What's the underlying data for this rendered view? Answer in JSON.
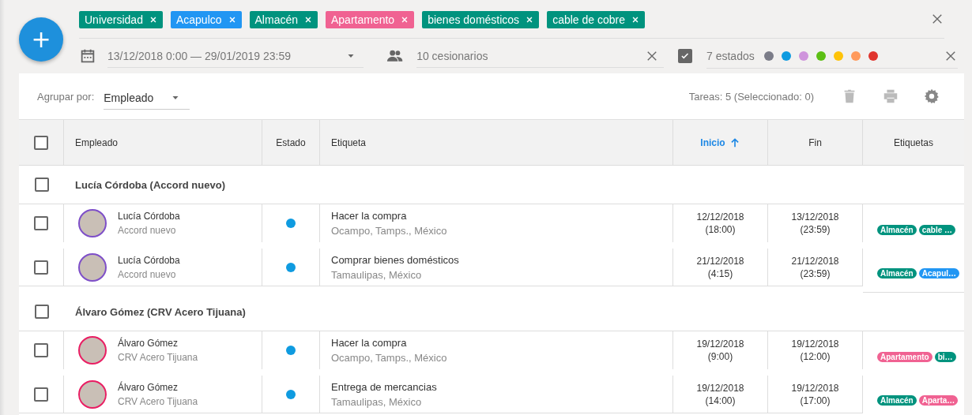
{
  "fab": {
    "label": "+"
  },
  "filter_tags": [
    {
      "label": "Universidad",
      "color": "#00937e"
    },
    {
      "label": "Acapulco",
      "color": "#2196f3"
    },
    {
      "label": "Almacén",
      "color": "#00937e"
    },
    {
      "label": "Apartamento",
      "color": "#f06292"
    },
    {
      "label": "bienes domésticos",
      "color": "#00937e"
    },
    {
      "label": "cable de cobre",
      "color": "#00937e"
    }
  ],
  "date_range": {
    "value": "13/12/2018 0:00 — 29/01/2019 23:59"
  },
  "assignees": {
    "value": "10 cesionarios"
  },
  "states": {
    "checked": true,
    "value": "7 estados",
    "colors": [
      {
        "color": "#7b7c88"
      },
      {
        "color": "#0f9be0"
      },
      {
        "color": "#cf94dc"
      },
      {
        "color": "#5cbf14"
      },
      {
        "color": "#fec309"
      },
      {
        "color": "#ff9a5c"
      },
      {
        "color": "#e0342e"
      }
    ]
  },
  "toolbar": {
    "group_label": "Agrupar por:",
    "group_value": "Empleado",
    "summary": "Tareas: 5 (Seleccionado: 0)"
  },
  "table": {
    "select_all": {
      "checked": false
    },
    "columns": [
      {
        "label": "Empleado",
        "sorted": false
      },
      {
        "label": "Estado",
        "sorted": false
      },
      {
        "label": "Etiqueta",
        "sorted": false
      },
      {
        "label": "Inicio",
        "sorted": true
      },
      {
        "label": "Fin",
        "sorted": false
      },
      {
        "label": "Etiquetas",
        "sorted": false
      }
    ],
    "groups": [
      {
        "title": "Lucía Córdoba (Accord nuevo)",
        "checked": false,
        "rows": [
          {
            "checked": false,
            "name": "Lucía Córdoba",
            "company": "Accord nuevo",
            "avatar": {
              "color": "#7e4fc8"
            },
            "status": {
              "color": "#0f9be0"
            },
            "task": "Hacer la compra",
            "place": "Ocampo, Tamps., México",
            "start": {
              "date": "12/12/2018",
              "time": "(18:00)"
            },
            "end": {
              "date": "13/12/2018",
              "time": "(23:59)"
            },
            "tags": [
              {
                "label": "Almacén",
                "color": "#00937e"
              },
              {
                "label": "cable …",
                "color": "#00937e"
              }
            ]
          },
          {
            "checked": false,
            "name": "Lucía Córdoba",
            "company": "Accord nuevo",
            "avatar": {
              "color": "#7e4fc8"
            },
            "status": {
              "color": "#0f9be0"
            },
            "task": "Comprar bienes domésticos",
            "place": "Tamaulipas, México",
            "start": {
              "date": "21/12/2018",
              "time": "(4:15)"
            },
            "end": {
              "date": "21/12/2018",
              "time": "(23:59)"
            },
            "tags": [
              {
                "label": "Almacén",
                "color": "#00937e"
              },
              {
                "label": "Acapul…",
                "color": "#2196f3"
              }
            ]
          }
        ]
      },
      {
        "title": "Álvaro Gómez (CRV Acero Tijuana)",
        "checked": false,
        "rows": [
          {
            "checked": false,
            "name": "Álvaro Gómez",
            "company": "CRV Acero Tijuana",
            "avatar": {
              "color": "#e91e63"
            },
            "status": {
              "color": "#0f9be0"
            },
            "task": "Hacer la compra",
            "place": "Ocampo, Tamps., México",
            "start": {
              "date": "19/12/2018",
              "time": "(9:00)"
            },
            "end": {
              "date": "19/12/2018",
              "time": "(12:00)"
            },
            "tags": [
              {
                "label": "Apartamento",
                "color": "#f06292"
              },
              {
                "label": "bi…",
                "color": "#00937e"
              }
            ]
          },
          {
            "checked": false,
            "name": "Álvaro Gómez",
            "company": "CRV Acero Tijuana",
            "avatar": {
              "color": "#e91e63"
            },
            "status": {
              "color": "#0f9be0"
            },
            "task": "Entrega de mercancias",
            "place": "Tamaulipas, México",
            "start": {
              "date": "19/12/2018",
              "time": "(14:00)"
            },
            "end": {
              "date": "19/12/2018",
              "time": "(17:00)"
            },
            "tags": [
              {
                "label": "Almacén",
                "color": "#00937e"
              },
              {
                "label": "Aparta…",
                "color": "#f06292"
              }
            ]
          }
        ]
      }
    ]
  }
}
